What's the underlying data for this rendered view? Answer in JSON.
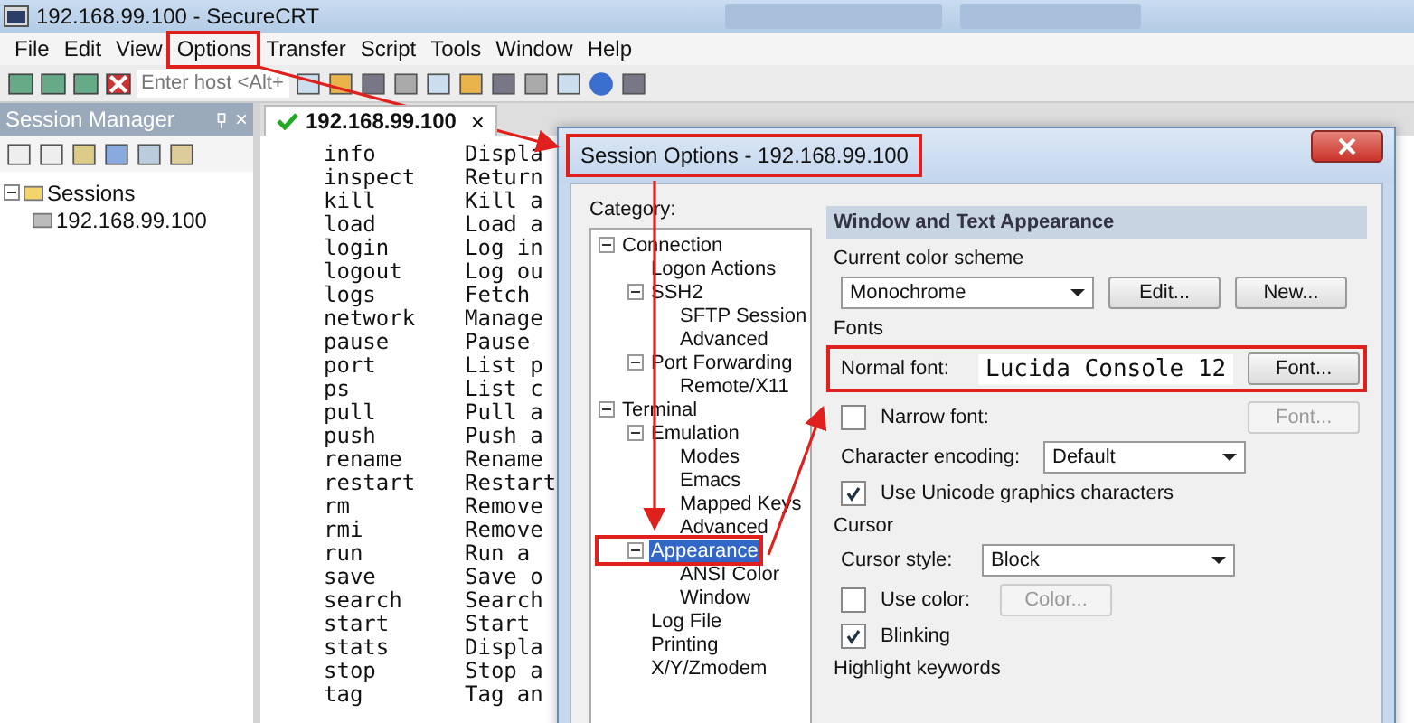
{
  "window": {
    "title": "192.168.99.100 - SecureCRT"
  },
  "menu": [
    "File",
    "Edit",
    "View",
    "Options",
    "Transfer",
    "Script",
    "Tools",
    "Window",
    "Help"
  ],
  "toolbar": {
    "host_placeholder": "Enter host <Alt+"
  },
  "session_manager": {
    "title": "Session Manager",
    "close": "×",
    "tree": [
      {
        "label": "Sessions",
        "expanded": true,
        "selected": false,
        "children": [
          {
            "label": "192.168.99.100",
            "selected": false
          }
        ]
      }
    ]
  },
  "tab": {
    "label": "192.168.99.100",
    "close": "×",
    "selected": true
  },
  "terminal": {
    "rows": [
      {
        "command": "info",
        "description": "Displa"
      },
      {
        "command": "inspect",
        "description": "Return"
      },
      {
        "command": "kill",
        "description": "Kill a"
      },
      {
        "command": "load",
        "description": "Load a"
      },
      {
        "command": "login",
        "description": "Log in"
      },
      {
        "command": "logout",
        "description": "Log ou"
      },
      {
        "command": "logs",
        "description": "Fetch"
      },
      {
        "command": "network",
        "description": "Manage"
      },
      {
        "command": "pause",
        "description": "Pause"
      },
      {
        "command": "port",
        "description": "List p"
      },
      {
        "command": "ps",
        "description": "List c"
      },
      {
        "command": "pull",
        "description": "Pull a"
      },
      {
        "command": "push",
        "description": "Push a"
      },
      {
        "command": "rename",
        "description": "Rename"
      },
      {
        "command": "restart",
        "description": "Restart"
      },
      {
        "command": "rm",
        "description": "Remove"
      },
      {
        "command": "rmi",
        "description": "Remove"
      },
      {
        "command": "run",
        "description": "Run a"
      },
      {
        "command": "save",
        "description": "Save o"
      },
      {
        "command": "search",
        "description": "Search"
      },
      {
        "command": "start",
        "description": "Start"
      },
      {
        "command": "stats",
        "description": "Displa"
      },
      {
        "command": "stop",
        "description": "Stop a"
      },
      {
        "command": "tag",
        "description": "Tag an"
      }
    ]
  },
  "dialog": {
    "title": "Session Options - 192.168.99.100",
    "category_label": "Category:",
    "tree": [
      {
        "label": "Connection",
        "expanded": true,
        "selected": false,
        "children": [
          {
            "label": "Logon Actions",
            "selected": false
          },
          {
            "label": "SSH2",
            "expanded": true,
            "selected": false,
            "children": [
              {
                "label": "SFTP Session",
                "selected": false
              },
              {
                "label": "Advanced",
                "selected": false
              }
            ]
          },
          {
            "label": "Port Forwarding",
            "expanded": true,
            "selected": false,
            "children": [
              {
                "label": "Remote/X11",
                "selected": false
              }
            ]
          }
        ]
      },
      {
        "label": "Terminal",
        "expanded": true,
        "selected": false,
        "children": [
          {
            "label": "Emulation",
            "expanded": true,
            "selected": false,
            "children": [
              {
                "label": "Modes",
                "selected": false
              },
              {
                "label": "Emacs",
                "selected": false
              },
              {
                "label": "Mapped Keys",
                "selected": false
              },
              {
                "label": "Advanced",
                "selected": false
              }
            ]
          },
          {
            "label": "Appearance",
            "expanded": true,
            "selected": true,
            "children": [
              {
                "label": "ANSI Color",
                "selected": false
              },
              {
                "label": "Window",
                "selected": false
              }
            ]
          },
          {
            "label": "Log File",
            "selected": false
          },
          {
            "label": "Printing",
            "selected": false
          },
          {
            "label": "X/Y/Zmodem",
            "selected": false
          }
        ]
      }
    ],
    "section_header": "Window and Text Appearance",
    "color_scheme": {
      "label": "Current color scheme",
      "value": "Monochrome",
      "buttons": [
        {
          "label": "Edit...",
          "disabled": false
        },
        {
          "label": "New...",
          "disabled": false
        }
      ]
    },
    "fonts": {
      "label": "Fonts",
      "normal_font": {
        "label": "Normal font:",
        "value": "Lucida Console 12",
        "button": {
          "label": "Font...",
          "disabled": false
        }
      },
      "narrow_font": {
        "label": "Narrow font:",
        "checked": false,
        "button": {
          "label": "Font...",
          "disabled": true
        }
      },
      "encoding": {
        "label": "Character encoding:",
        "value": "Default"
      },
      "unicode": {
        "label": "Use Unicode graphics characters",
        "checked": true
      }
    },
    "cursor": {
      "label": "Cursor",
      "style": {
        "label": "Cursor style:",
        "value": "Block"
      },
      "use_color": {
        "label": "Use color:",
        "checked": false,
        "button": {
          "label": "Color...",
          "disabled": true
        }
      },
      "blinking": {
        "label": "Blinking",
        "checked": true
      }
    },
    "highlight_label": "Highlight keywords"
  }
}
